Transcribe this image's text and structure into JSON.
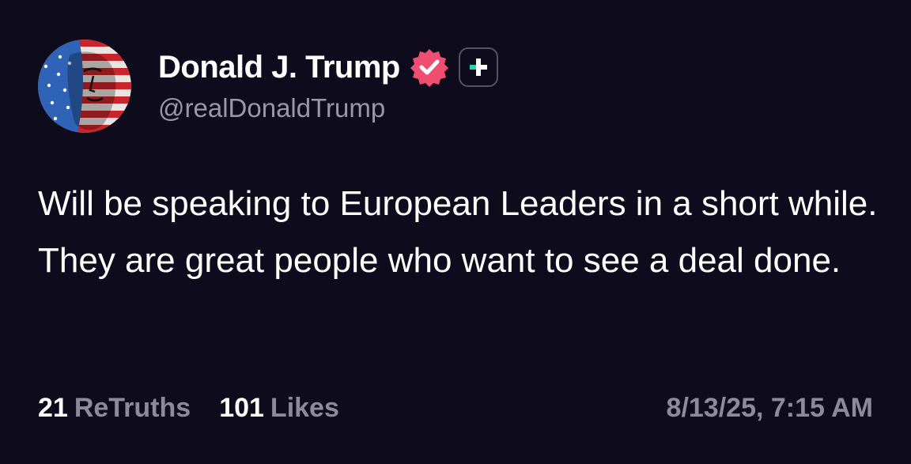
{
  "post": {
    "author": {
      "display_name": "Donald J. Trump",
      "handle": "@realDonaldTrump",
      "avatar_icon": "flag-portrait-avatar",
      "verified_icon": "verified-badge-icon",
      "plus_icon": "plus-badge-icon"
    },
    "text": "Will be speaking to European Leaders in a short while. They are great people who want to see a deal done.",
    "stats": {
      "retruths_count": "21",
      "retruths_label": "ReTruths",
      "likes_count": "101",
      "likes_label": "Likes"
    },
    "timestamp": "8/13/25, 7:15 AM"
  },
  "colors": {
    "background": "#0e0b1c",
    "verified_badge": "#ee4f70",
    "plus_icon_teal": "#23d7b6",
    "secondary_text": "#8d8a9c"
  }
}
